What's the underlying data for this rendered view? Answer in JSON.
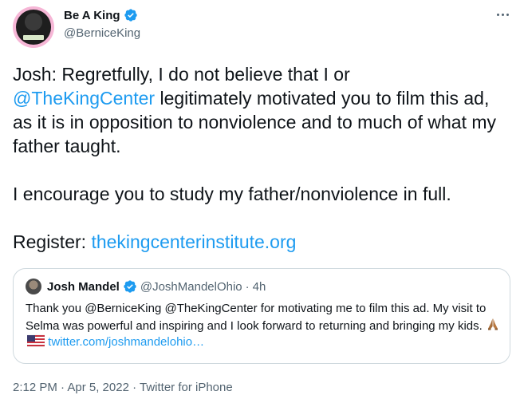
{
  "author": {
    "display_name": "Be A King",
    "handle": "@BerniceKing"
  },
  "tweet": {
    "line1": "Josh: Regretfully, I do not believe that I or",
    "mention": "@TheKingCenter",
    "line2_rest": " legitimately motivated you to film this ad, as it is in opposition to nonviolence and to much of what my father taught.",
    "para2": "I encourage you to study my father/nonviolence in full.",
    "register_label": "Register: ",
    "register_link": "thekingcenterinstitute.org"
  },
  "quoted": {
    "display_name": "Josh Mandel",
    "handle": "@JoshMandelOhio",
    "separator": "·",
    "time": "4h",
    "text_before_emoji": "Thank you @BerniceKing @TheKingCenter for motivating me to film this ad. My visit to Selma was powerful and inspiring and I look forward to returning and bringing my kids. ",
    "text_after_emoji": " twitter.com/joshmandelohio…",
    "emojis": [
      "folded-hands-icon",
      "us-flag-icon"
    ]
  },
  "meta": {
    "text": "2:12 PM · Apr 5, 2022 · Twitter for iPhone"
  },
  "colors": {
    "link": "#1d9bf0",
    "secondary_text": "#536471",
    "border": "#cfd9de",
    "verified": "#1d9bf0"
  }
}
